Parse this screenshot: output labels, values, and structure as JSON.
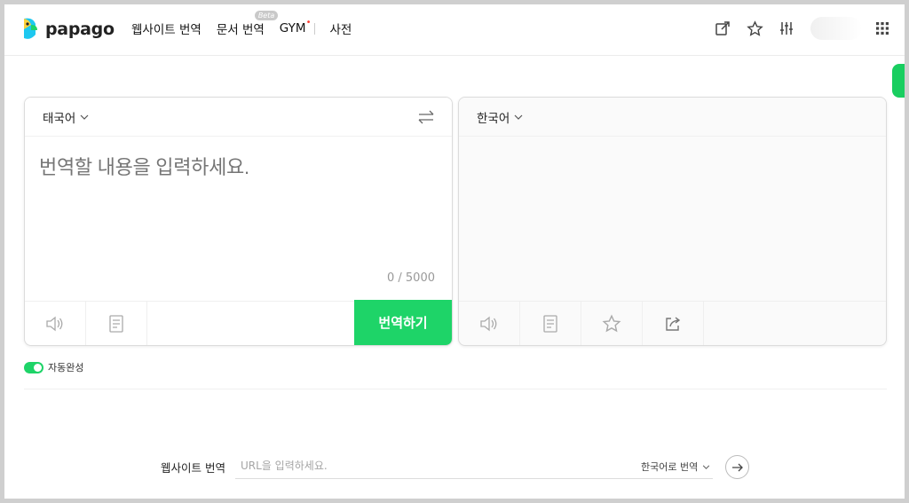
{
  "brand": {
    "name": "papago",
    "accent": "#1ed468"
  },
  "nav": {
    "website": "웹사이트 번역",
    "document": "문서 번역",
    "document_badge": "Beta",
    "gym": "GYM",
    "gym_badge": "•",
    "dictionary": "사전"
  },
  "header_icons": [
    "open-external-icon",
    "star-icon",
    "settings-sliders-icon",
    "apps-grid-icon"
  ],
  "source": {
    "language": "태국어",
    "placeholder": "번역할 내용을 입력하세요.",
    "counter": "0 / 5000",
    "translate_label": "번역하기"
  },
  "target": {
    "language": "한국어"
  },
  "autocomplete": {
    "label": "자동완성",
    "enabled": true
  },
  "website_translate": {
    "label": "웹사이트 번역",
    "placeholder": "URL을 입력하세요.",
    "target_option": "한국어로 번역"
  }
}
